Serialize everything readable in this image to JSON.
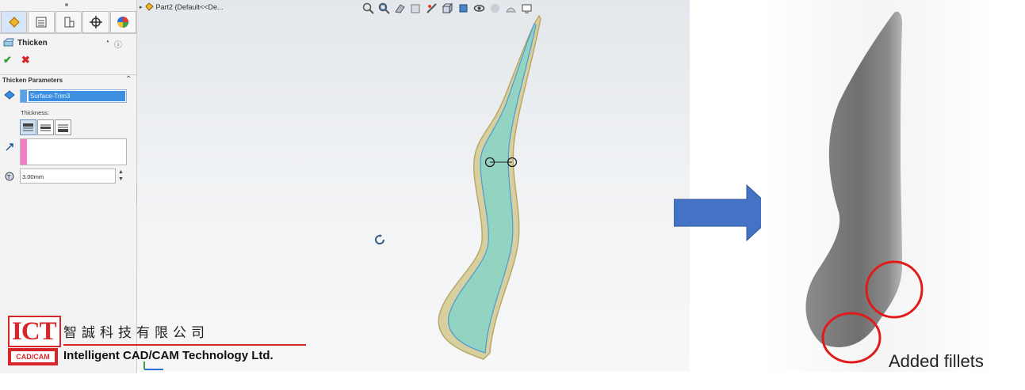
{
  "feature_tree": {
    "breadcrumb": "Part2  (Default<<De..."
  },
  "property_manager": {
    "title": "Thicken",
    "ok_symbol": "✔",
    "cancel_symbol": "✖",
    "section_title": "Thicken Parameters",
    "selected_surface": "Surface-Trim3",
    "thickness_label": "Thickness:",
    "thickness_value": "3.00mm"
  },
  "annotation": {
    "text": "Added fillets"
  },
  "logo": {
    "abbr": "ICT",
    "sub": "CAD/CAM",
    "chinese_name": "智誠科技有限公司",
    "english_name": "Intelligent CAD/CAM Technology Ltd."
  },
  "colors": {
    "accent": "#d6262c",
    "arrow": "#4472c4",
    "model_fill": "#8fd3c0",
    "highlight_circle": "#e01b1b"
  }
}
